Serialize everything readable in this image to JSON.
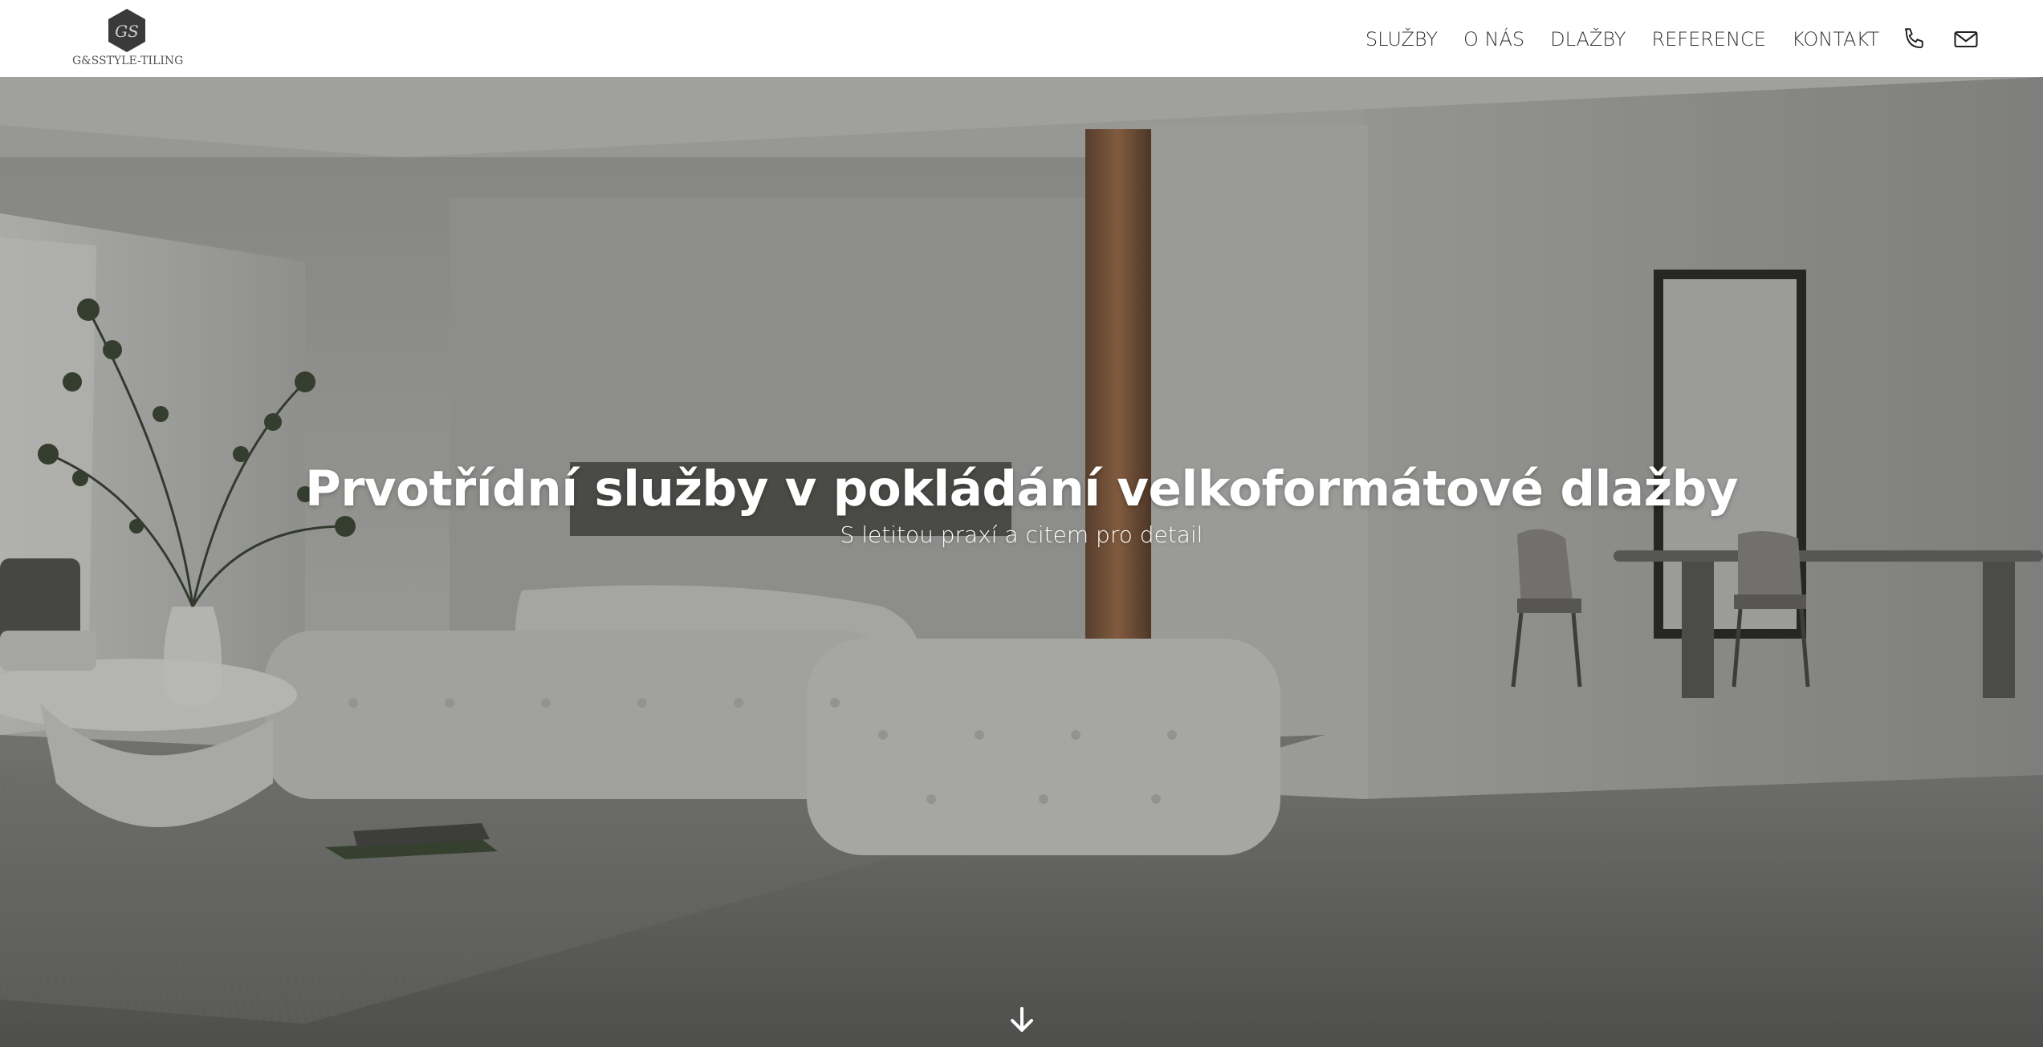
{
  "header": {
    "logo": {
      "monogram": "GS",
      "text": "G&SSTYLE-TILING"
    },
    "nav": [
      {
        "label": "SLUŽBY"
      },
      {
        "label": "O NÁS"
      },
      {
        "label": "DLAŽBY"
      },
      {
        "label": "REFERENCE"
      },
      {
        "label": "KONTAKT"
      }
    ],
    "icons": {
      "phone": "phone-icon",
      "mail": "mail-icon"
    }
  },
  "hero": {
    "title": "Prvotřídní služby v pokládání velkoformátové dlažby",
    "subtitle": "S letitou praxí a citem pro detail",
    "scroll_icon": "arrow-down-icon"
  },
  "colors": {
    "header_bg": "#ffffff",
    "nav_text": "#333333",
    "hero_text": "#ffffff",
    "logo_hex": "#3a3a3a"
  }
}
